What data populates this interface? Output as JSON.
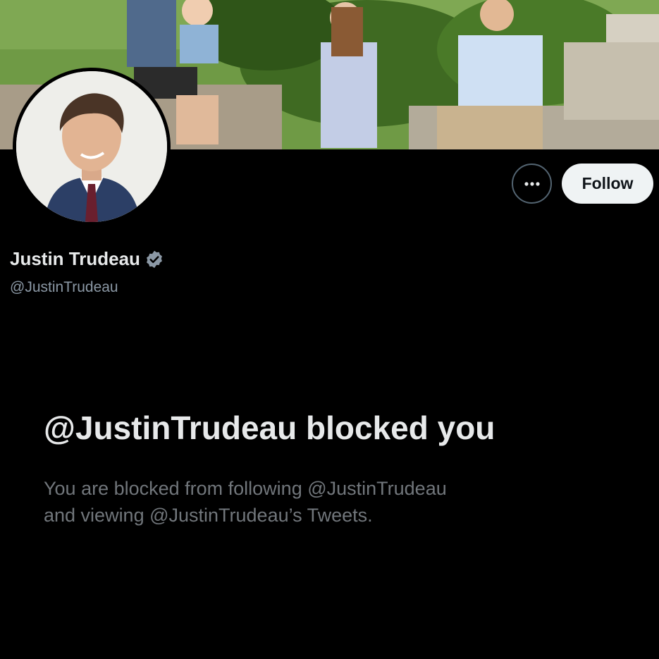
{
  "profile": {
    "display_name": "Justin Trudeau",
    "handle": "@JustinTrudeau",
    "verified": true
  },
  "actions": {
    "more_icon": "more-dots-icon",
    "follow_label": "Follow"
  },
  "blocked": {
    "title": "@JustinTrudeau blocked you",
    "line1": "You are blocked from following @JustinTrudeau",
    "line2": "and viewing @JustinTrudeau’s Tweets."
  },
  "colors": {
    "background": "#000000",
    "primary_text": "#e7e9ea",
    "secondary_text": "#71767b",
    "follow_button_bg": "#eff3f4",
    "verified_badge": "#8b98a5"
  }
}
